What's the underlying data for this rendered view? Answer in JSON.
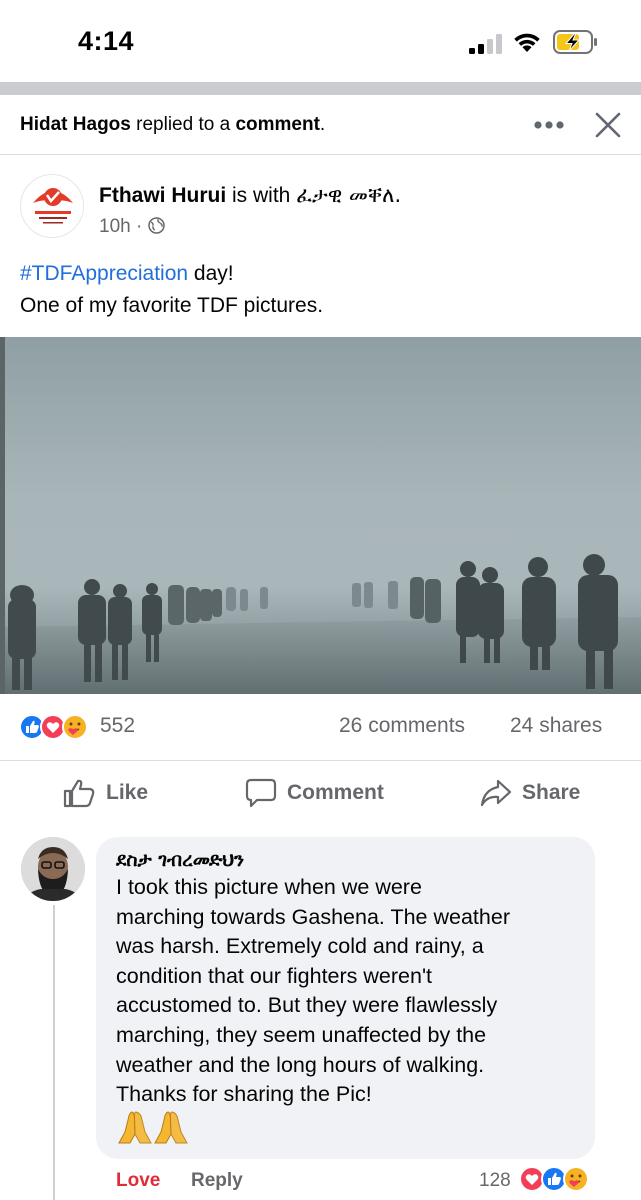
{
  "status_bar": {
    "time": "4:14",
    "signal_icon": "cellular-signal-icon",
    "wifi_icon": "wifi-icon",
    "battery_icon": "battery-charging-icon"
  },
  "notification": {
    "actor": "Hidat Hagos",
    "action_text": " replied to a ",
    "object": "comment",
    "period": ".",
    "more_icon": "more-options-icon",
    "close_icon": "close-icon"
  },
  "post": {
    "author": "Fthawi Hurui",
    "with_text": " is with ",
    "tagged": "ፈታዊ መቐለ.",
    "time": "10h",
    "meta_separator": " · ",
    "privacy_icon": "globe-icon",
    "hashtag": "#TDFAppreciation",
    "line1_rest": " day!",
    "line2": "One of my favorite TDF pictures.",
    "photo": "foggy-road-marching-photo",
    "reaction_count": "552",
    "comments": "26 comments",
    "shares": "24 shares",
    "reaction_icons": [
      "like-icon",
      "love-icon",
      "care-icon"
    ]
  },
  "actions": {
    "like": "Like",
    "comment": "Comment",
    "share": "Share"
  },
  "comment": {
    "author": "ደስታ ገብረመድህን",
    "lines": [
      "I took this picture when we were",
      "marching towards Gashena. The weather",
      "was harsh. Extremely cold and rainy, a",
      "condition that our fighters weren't",
      "accustomed to. But they were flawlessly",
      "marching, they seem unaffected by the",
      "weather and the long hours of walking.",
      "Thanks for sharing the Pic!"
    ],
    "emoji": "🙏🙏",
    "love_label": "Love",
    "reply_label": "Reply",
    "reaction_count": "128",
    "reaction_icons": [
      "love-icon",
      "like-icon",
      "care-icon"
    ]
  },
  "colors": {
    "facebook_blue": "#216fdb",
    "love_red": "#e02c3a",
    "secondary_text": "#65676b"
  }
}
